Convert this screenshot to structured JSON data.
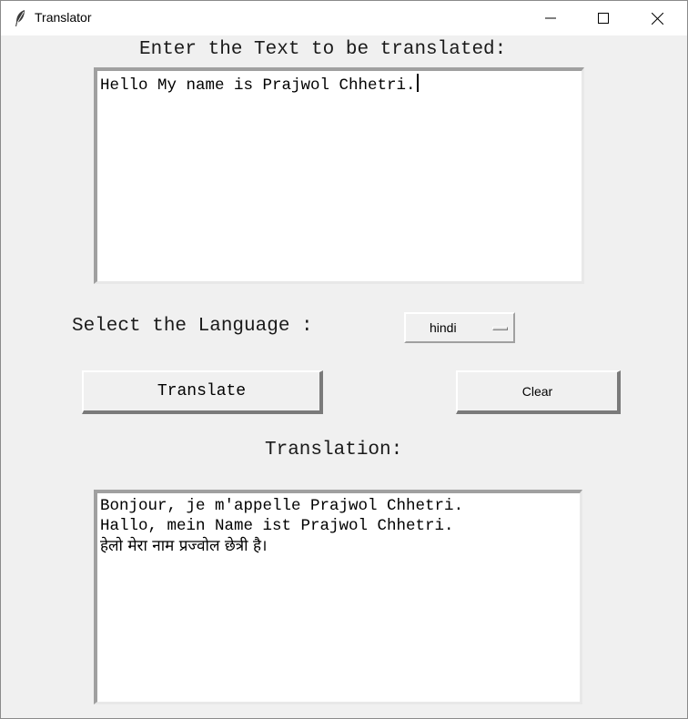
{
  "window": {
    "title": "Translator",
    "controls": [
      "minimize",
      "maximize",
      "close"
    ]
  },
  "input_section": {
    "prompt_label": "Enter the Text to be translated:",
    "text_value": "Hello My name is Prajwol Chhetri."
  },
  "language_section": {
    "label": "Select the Language :",
    "selected_language": "hindi"
  },
  "buttons": {
    "translate_label": "Translate",
    "clear_label": "Clear"
  },
  "output_section": {
    "label": "Translation:",
    "lines": [
      "Bonjour, je m'appelle Prajwol Chhetri.",
      "Hallo, mein Name ist Prajwol Chhetri.",
      "हेलो मेरा नाम प्रज्वोल छेत्री है।"
    ]
  },
  "icons": {
    "app_icon": "feather-icon",
    "minimize": "minimize-icon",
    "maximize": "maximize-icon",
    "close": "close-icon"
  },
  "colors": {
    "window_background": "#f0f0f0",
    "titlebar_background": "#ffffff",
    "textbox_background": "#ffffff"
  }
}
